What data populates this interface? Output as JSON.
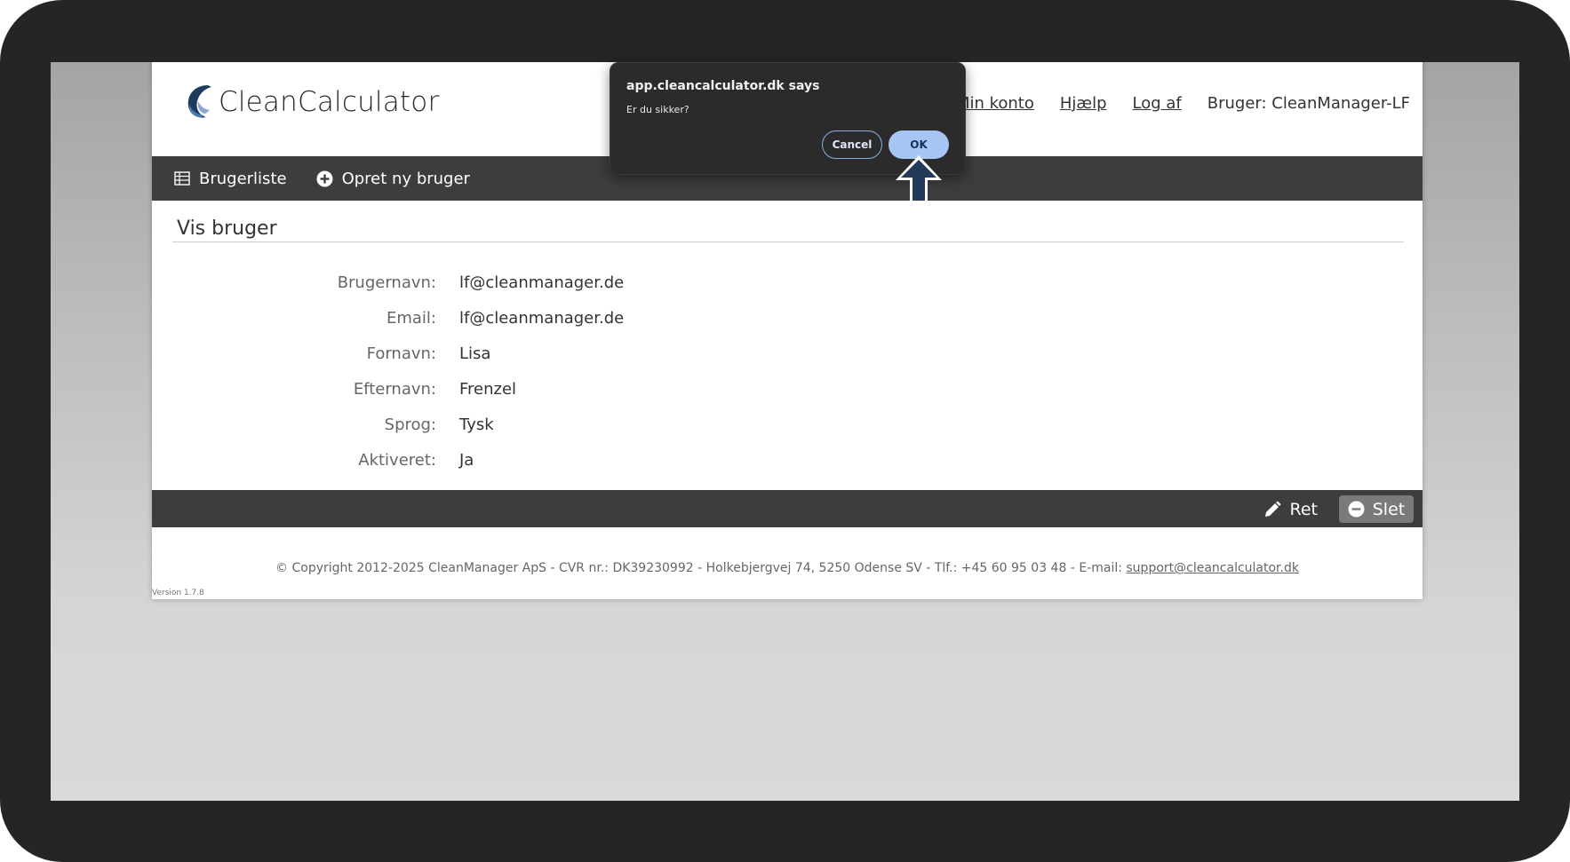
{
  "app": {
    "logo_text": "CleanCalculator",
    "brand_colors": {
      "logo_dark": "#1f3b5c",
      "logo_light": "#4d79b0",
      "bar": "#3d3d3d"
    }
  },
  "topnav": {
    "min_konto": "Min konto",
    "hjaelp": "Hjælp",
    "log_af": "Log af",
    "user": "Bruger: CleanManager-LF"
  },
  "toolbar": {
    "brugerliste": "Brugerliste",
    "opret": "Opret ny bruger"
  },
  "content": {
    "title": "Vis bruger",
    "fields": [
      {
        "label": "Brugernavn:",
        "value": "lf@cleanmanager.de"
      },
      {
        "label": "Email:",
        "value": "lf@cleanmanager.de"
      },
      {
        "label": "Fornavn:",
        "value": "Lisa"
      },
      {
        "label": "Efternavn:",
        "value": "Frenzel"
      },
      {
        "label": "Sprog:",
        "value": "Tysk"
      },
      {
        "label": "Aktiveret:",
        "value": "Ja"
      }
    ]
  },
  "actions": {
    "ret": "Ret",
    "slet": "Slet"
  },
  "footer": {
    "text": "© Copyright 2012-2025 CleanManager ApS - CVR nr.: DK39230992 - Holkebjergvej 74, 5250 Odense SV - Tlf.: +45 60 95 03 48 - E-mail: ",
    "email": "support@cleancalculator.dk",
    "version": "Version 1.7.8"
  },
  "dialog": {
    "title": "app.cleancalculator.dk says",
    "message": "Er du sikker?",
    "cancel": "Cancel",
    "ok": "OK"
  },
  "icons": [
    "table-icon",
    "plus-circle-icon",
    "pencil-icon",
    "minus-circle-icon",
    "up-arrow-icon",
    "logo-icon"
  ]
}
